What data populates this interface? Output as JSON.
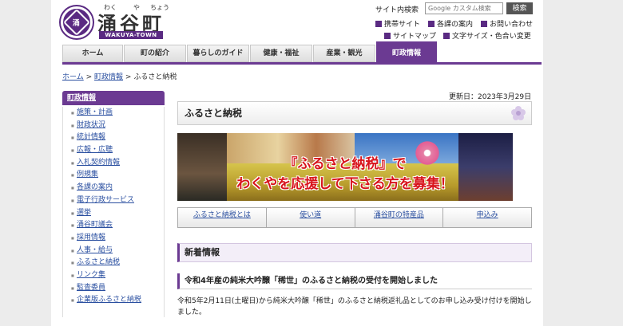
{
  "header": {
    "ruby": [
      "わく",
      "や",
      "ちょう"
    ],
    "site_title": "涌谷町",
    "site_subtitle": "WAKUYA-TOWN",
    "search_label": "サイト内検索",
    "search_placeholder": "Google カスタム検索",
    "search_button": "検索",
    "links": [
      "携帯サイト",
      "各課の案内",
      "お問い合わせ",
      "サイトマップ",
      "文字サイズ・色合い変更"
    ]
  },
  "nav": {
    "items": [
      "ホーム",
      "町の紹介",
      "暮らしのガイド",
      "健康・福祉",
      "産業・観光",
      "町政情報"
    ],
    "active": "町政情報"
  },
  "breadcrumb": {
    "home": "ホーム",
    "sep": ">",
    "section": "町政情報",
    "current": "ふるさと納税"
  },
  "sidebar": {
    "heading": "町政情報",
    "items": [
      "施策・計画",
      "財政状況",
      "統計情報",
      "広報・広聴",
      "入札契約情報",
      "例規集",
      "各課の案内",
      "電子行政サービス",
      "選挙",
      "涌谷町議会",
      "採用情報",
      "人事・給与",
      "ふるさと納税",
      "リンク集",
      "監査委員",
      "企業版ふるさと納税"
    ]
  },
  "main": {
    "updated": "更新日：2023年3月29日",
    "page_title": "ふるさと納税",
    "banner_line1": "『ふるさと納税』で",
    "banner_line2": "わくやを応援して下さる方を募集！",
    "tabs": [
      "ふるさと納税とは",
      "使い道",
      "涌谷町の特産品",
      "申込み"
    ],
    "news_heading": "新着情報",
    "article_title": "令和4年産の純米大吟醸「稀世」のふるさと納税の受付を開始しました",
    "article_body": "令和5年2月11日(土曜日)から純米大吟醸「稀世」のふるさと納税返礼品としてのお申し込み受け付けを開始しました。"
  },
  "colors": {
    "accent": "#6b3a92",
    "link": "#2a4fa0",
    "banner_text": "#d8141c"
  },
  "icons": [
    "town-emblem-icon",
    "flower-icon"
  ]
}
